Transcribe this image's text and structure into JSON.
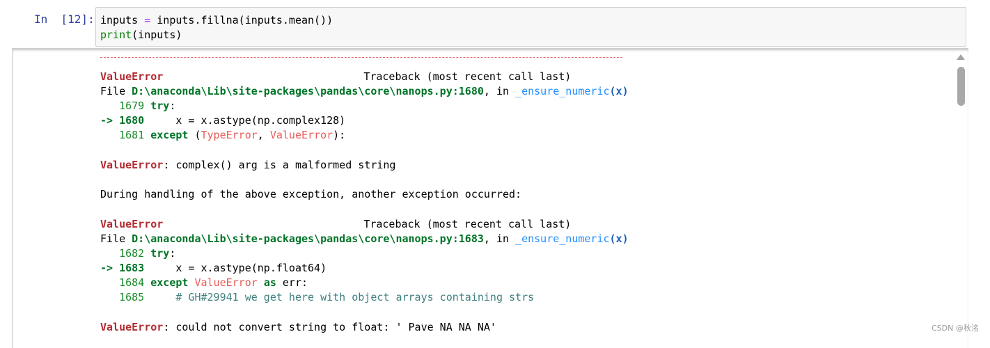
{
  "cell": {
    "prompt": "In  [12]:",
    "code": {
      "line1": {
        "var": "inputs",
        "op": "=",
        "rest": "inputs.fillna(inputs.mean())"
      },
      "line2": {
        "builtin": "print",
        "rest": "(inputs)"
      }
    }
  },
  "traceback": {
    "block1": {
      "error_name": "ValueError",
      "traceback_header": "Traceback (most recent call last)",
      "file_prefix": "File ",
      "file_path": "D:\\anaconda\\Lib\\site-packages\\pandas\\core\\nanops.py:1680",
      "in_text": ", in ",
      "func_name": "_ensure_numeric",
      "func_arg": "(x)",
      "lines": [
        {
          "no": "1679",
          "code_kw": "try",
          "code_rest": ":"
        },
        {
          "arrow": "->",
          "no": "1680",
          "code": "x = x.astype(np.complex128)"
        },
        {
          "no": "1681",
          "code_kw": "except",
          "paren_open": "(",
          "exc1": "TypeError",
          "sep": ", ",
          "exc2": "ValueError",
          "paren_close": "):"
        }
      ],
      "message_name": "ValueError",
      "message_text": ": complex() arg is a malformed string"
    },
    "during_handling": "During handling of the above exception, another exception occurred:",
    "block2": {
      "error_name": "ValueError",
      "traceback_header": "Traceback (most recent call last)",
      "file_prefix": "File ",
      "file_path": "D:\\anaconda\\Lib\\site-packages\\pandas\\core\\nanops.py:1683",
      "in_text": ", in ",
      "func_name": "_ensure_numeric",
      "func_arg": "(x)",
      "lines": [
        {
          "no": "1682",
          "code_kw": "try",
          "code_rest": ":"
        },
        {
          "arrow": "->",
          "no": "1683",
          "code": "x = x.astype(np.float64)"
        },
        {
          "no": "1684",
          "code_kw": "except",
          "exc": "ValueError",
          "as_kw": "as",
          "code_rest": "err:"
        },
        {
          "no": "1685",
          "comment": "# GH#29941 we get here with object arrays containing strs"
        }
      ],
      "message_name": "ValueError",
      "message_text": ": could not convert string to float: ' Pave NA NA NA'"
    }
  },
  "watermark": "CSDN @秋洺"
}
